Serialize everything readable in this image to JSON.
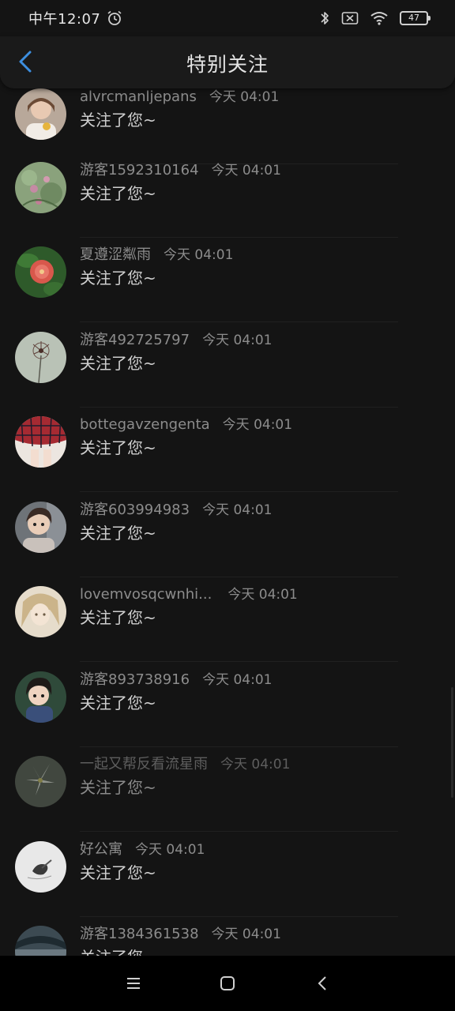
{
  "status_bar": {
    "time": "中午12:07",
    "alarm_icon": "alarm-icon",
    "bluetooth_icon": "bluetooth-icon",
    "sim_icon": "no-sim-icon",
    "wifi_icon": "wifi-icon",
    "battery_level": "47"
  },
  "header": {
    "back_icon": "chevron-left-icon",
    "title": "特别关注",
    "accent_color": "#3d8fe0"
  },
  "list": {
    "items": [
      {
        "username": "alvrcmanljepans",
        "time": "今天 04:01",
        "message": "关注了您~",
        "avatar": "girl-photo"
      },
      {
        "username": "游客1592310164",
        "time": "今天 04:01",
        "message": "关注了您~",
        "avatar": "lotus-flowers"
      },
      {
        "username": "夏遵涩粼雨",
        "time": "今天 04:01",
        "message": "关注了您~",
        "avatar": "red-flower"
      },
      {
        "username": "游客492725797",
        "time": "今天 04:01",
        "message": "关注了您~",
        "avatar": "dandelion"
      },
      {
        "username": "bottegavzengenta",
        "time": "今天 04:01",
        "message": "关注了您~",
        "avatar": "red-plaid-skirt"
      },
      {
        "username": "游客603994983",
        "time": "今天 04:01",
        "message": "关注了您~",
        "avatar": "child-photo"
      },
      {
        "username": "lovemvosqcwnhi...",
        "time": "今天 04:01",
        "message": "关注了您~",
        "avatar": "anime-girl"
      },
      {
        "username": "游客893738916",
        "time": "今天 04:01",
        "message": "关注了您~",
        "avatar": "little-girl"
      },
      {
        "username": "一起又帮反看流星雨",
        "time": "今天 04:01",
        "message": "关注了您~",
        "avatar": "white-lily"
      },
      {
        "username": "好公寓",
        "time": "今天 04:01",
        "message": "关注了您~",
        "avatar": "sketch-drawing"
      },
      {
        "username": "游客1384361538",
        "time": "今天 04:01",
        "message": "关注了您~",
        "avatar": "dark-photo"
      }
    ]
  },
  "nav_bar": {
    "menu_icon": "menu-icon",
    "home_icon": "home-icon",
    "back_icon": "back-icon"
  }
}
